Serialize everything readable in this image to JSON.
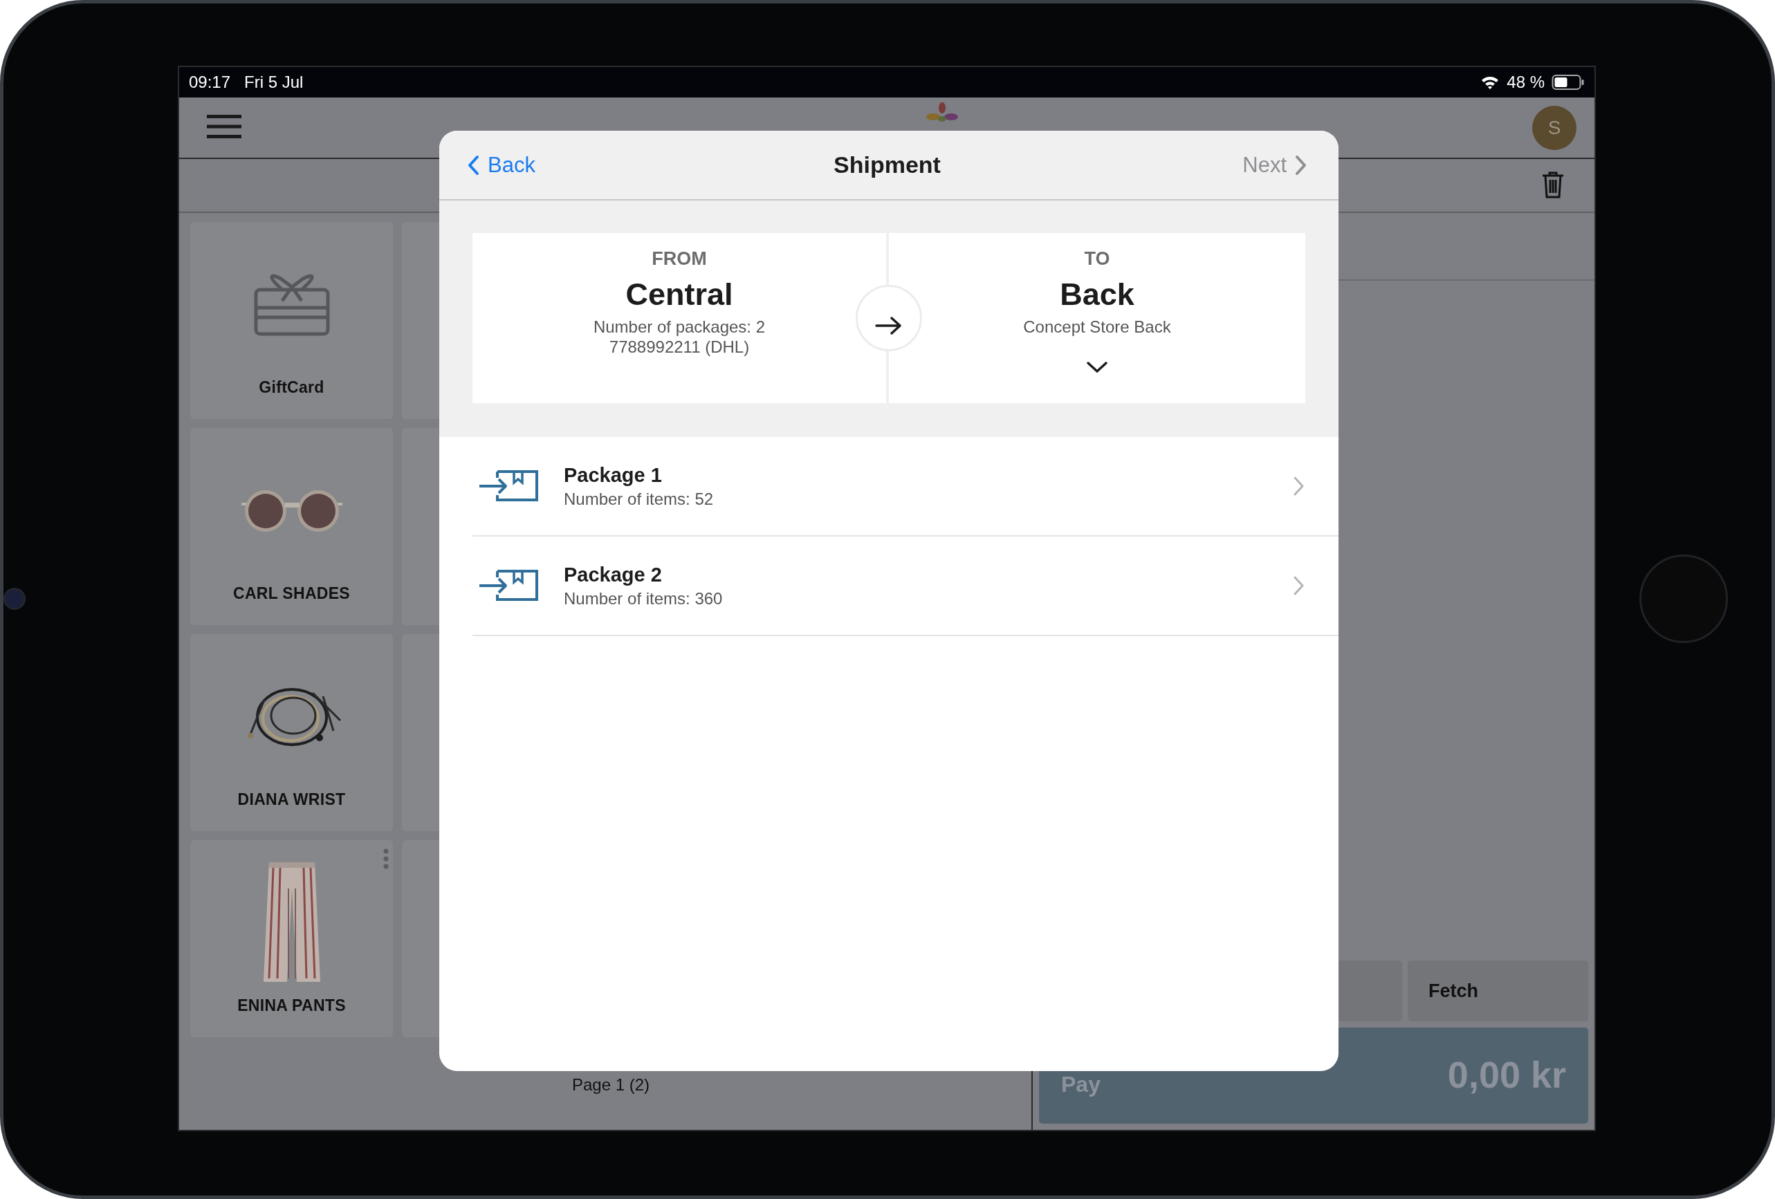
{
  "status_bar": {
    "time": "09:17",
    "date": "Fri 5 Jul",
    "battery": "48 %"
  },
  "header": {
    "avatar": "S"
  },
  "products": [
    {
      "name": "GiftCard",
      "kind": "icon",
      "has_menu": false
    },
    {
      "name": "CARL SHADES",
      "kind": "picture",
      "has_menu": false
    },
    {
      "name": "DIANA WRIST",
      "kind": "picture",
      "has_menu": false
    },
    {
      "name": "ENINA PANTS",
      "kind": "picture",
      "has_menu": true
    }
  ],
  "pager": "Page 1 (2)",
  "actions": [
    {
      "label": "Fetch"
    }
  ],
  "pay": {
    "label": "Pay",
    "amount": "0,00 kr",
    "disabled": true
  },
  "dialog": {
    "title": "Shipment",
    "back": "Back",
    "next": "Next",
    "next_disabled": true,
    "from": {
      "heading": "FROM",
      "name": "Central",
      "lines": [
        "Number of packages: 2",
        "7788992211 (DHL)"
      ]
    },
    "to": {
      "heading": "TO",
      "name": "Back",
      "lines": [
        "Concept Store Back"
      ]
    },
    "packages": [
      {
        "title": "Package 1",
        "subtitle": "Number of items: 52"
      },
      {
        "title": "Package 2",
        "subtitle": "Number of items: 360"
      }
    ]
  }
}
